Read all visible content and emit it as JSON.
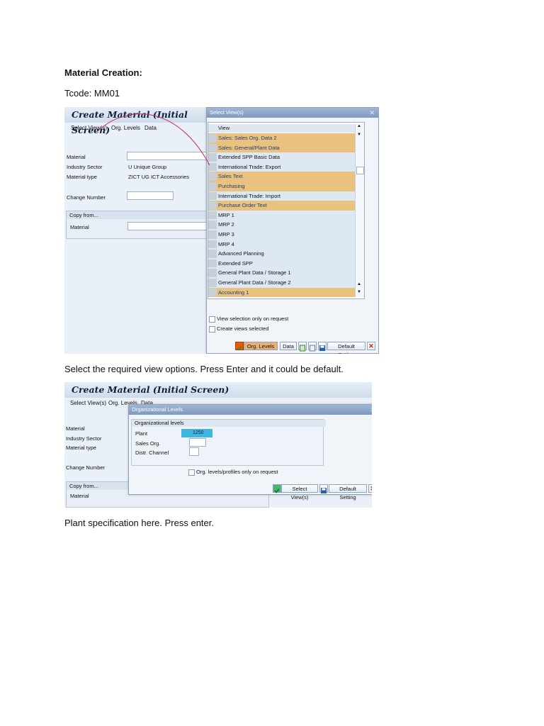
{
  "doc": {
    "heading": "Material Creation:",
    "tcode": "Tcode: MM01",
    "instruction1": "Select the required view options. Press Enter and it could be default.",
    "instruction2": "Plant specification here. Press enter."
  },
  "shot1": {
    "title": "Create Material (Initial Screen)",
    "menu": [
      "Select View(s)",
      "Org. Levels",
      "Data"
    ],
    "fields": {
      "material_label": "Material",
      "industry_label": "Industry Sector",
      "industry_value": "U Unique Group",
      "type_label": "Material type",
      "type_value": "ZICT UG ICT Accessories",
      "change_label": "Change Number"
    },
    "copy_from": {
      "header": "Copy from...",
      "material_label": "Material"
    },
    "dialog": {
      "title": "Select View(s)",
      "column": "View",
      "views": [
        {
          "label": "Sales: Sales Org. Data 2",
          "selected": true
        },
        {
          "label": "Sales: General/Plant Data",
          "selected": true
        },
        {
          "label": "Extended SPP Basic Data",
          "selected": false
        },
        {
          "label": "International Trade: Export",
          "selected": false
        },
        {
          "label": "Sales Text",
          "selected": true
        },
        {
          "label": "Purchasing",
          "selected": true
        },
        {
          "label": "International Trade: Import",
          "selected": false
        },
        {
          "label": "Purchase Order Text",
          "selected": true
        },
        {
          "label": "MRP 1",
          "selected": false
        },
        {
          "label": "MRP 2",
          "selected": false
        },
        {
          "label": "MRP 3",
          "selected": false
        },
        {
          "label": "MRP 4",
          "selected": false
        },
        {
          "label": "Advanced Planning",
          "selected": false
        },
        {
          "label": "Extended SPP",
          "selected": false
        },
        {
          "label": "General Plant Data / Storage 1",
          "selected": false
        },
        {
          "label": "General Plant Data / Storage 2",
          "selected": false
        },
        {
          "label": "Accounting 1",
          "selected": true
        }
      ],
      "check1": "View selection only on request",
      "check2": "Create views selected",
      "btn_org": "Org. Levels",
      "btn_data": "Data",
      "btn_default": "Default Setting"
    }
  },
  "shot2": {
    "title": "Create Material (Initial Screen)",
    "menu": [
      "Select View(s)",
      "Org. Levels",
      "Data"
    ],
    "fields": {
      "material_label": "Material",
      "industry_label": "Industry Sector",
      "type_label": "Material type",
      "change_label": "Change Number"
    },
    "copy_from": {
      "header": "Copy from...",
      "material_label": "Material"
    },
    "dialog": {
      "title": "Organizational Levels",
      "group": "Organizational levels",
      "plant_label": "Plant",
      "plant_value": "1250",
      "sales_label": "Sales Org.",
      "distr_label": "Distr. Channel",
      "check": "Org. levels/profiles only on request",
      "btn_views": "Select View(s)",
      "btn_default": "Default Setting"
    }
  },
  "colors": {
    "selected_view": "#e9c27f",
    "plant_highlight": "#3fb6e0",
    "arrow": "#c0306a"
  }
}
